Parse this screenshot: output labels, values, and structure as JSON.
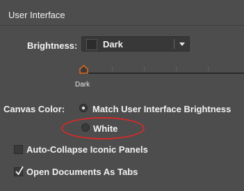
{
  "section": {
    "title": "User Interface"
  },
  "brightness": {
    "label": "Brightness:",
    "selected_value": "Dark",
    "slider": {
      "caption": "Dark",
      "position": 0
    }
  },
  "canvas_color": {
    "label": "Canvas Color:",
    "options": [
      {
        "label": "Match User Interface Brightness",
        "selected": true
      },
      {
        "label": "White",
        "selected": false
      }
    ],
    "highlight_color": "#d42a2a"
  },
  "checkboxes": [
    {
      "label": "Auto-Collapse Iconic Panels",
      "checked": false
    },
    {
      "label": "Open Documents As Tabs",
      "checked": true
    }
  ],
  "icons": {
    "dropdown_arrow": "chevron-down-icon",
    "slider_thumb": "slider-thumb-icon",
    "checkmark": "checkmark-icon"
  }
}
